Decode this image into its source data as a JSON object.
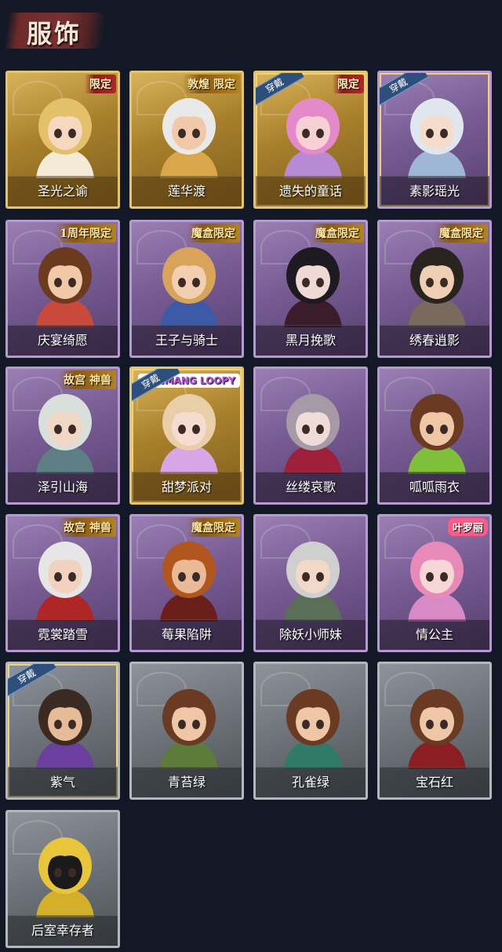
{
  "page": {
    "title": "服饰"
  },
  "cards": [
    {
      "name": "圣光之谕",
      "badge": "限定",
      "badge_style": "red",
      "frame": "gold",
      "worn": false,
      "hair": "#e4c06a",
      "skin": "#f6d8c0",
      "cloth": "#f3ead8"
    },
    {
      "name": "莲华渡",
      "badge": "敦煌 限定",
      "badge_style": "yellow",
      "frame": "gold",
      "worn": false,
      "hair": "#e9e9e9",
      "skin": "#f0caa8",
      "cloth": "#d9a64a"
    },
    {
      "name": "遗失的童话",
      "badge": "限定",
      "badge_style": "red",
      "frame": "gold",
      "worn": true,
      "worn_tag": "穿戴",
      "hair": "#e48acb",
      "skin": "#f7d0d6",
      "cloth": "#b88ad6"
    },
    {
      "name": "素影瑶光",
      "badge": "",
      "badge_style": "",
      "frame": "purple",
      "worn": true,
      "worn_tag": "穿戴",
      "hair": "#dfe6ee",
      "skin": "#f5dccd",
      "cloth": "#9fb6d6"
    },
    {
      "name": "庆宴绮愿",
      "badge": "1周年限定",
      "badge_style": "yellow",
      "frame": "purple",
      "worn": false,
      "hair": "#6b3a1f",
      "skin": "#f1c8a8",
      "cloth": "#c94a3b"
    },
    {
      "name": "王子与骑士",
      "badge": "魔盒限定",
      "badge_style": "yellow",
      "frame": "purple",
      "worn": false,
      "hair": "#d8a45a",
      "skin": "#f2cfb0",
      "cloth": "#3d5aa8"
    },
    {
      "name": "黑月挽歌",
      "badge": "魔盒限定",
      "badge_style": "yellow",
      "frame": "purple",
      "worn": false,
      "hair": "#1e1a22",
      "skin": "#efd9d4",
      "cloth": "#3a1c2a"
    },
    {
      "name": "绣春逍影",
      "badge": "魔盒限定",
      "badge_style": "yellow",
      "frame": "purple",
      "worn": false,
      "hair": "#2a2420",
      "skin": "#efcfb4",
      "cloth": "#7a6a5e"
    },
    {
      "name": "泽引山海",
      "badge": "故宫 神兽",
      "badge_style": "yellow",
      "frame": "purple",
      "worn": false,
      "hair": "#d9e0dc",
      "skin": "#f1d8c6",
      "cloth": "#5e7e86"
    },
    {
      "name": "甜梦派对",
      "badge": "ZANMANG LOOPY",
      "badge_style": "loopy",
      "frame": "gold",
      "worn": true,
      "worn_tag": "穿戴",
      "hair": "#e8cfa8",
      "skin": "#f6dcd0",
      "cloth": "#d7a6e6"
    },
    {
      "name": "丝缕哀歌",
      "badge": "",
      "badge_style": "",
      "frame": "purple",
      "worn": false,
      "hair": "#a59aa6",
      "skin": "#efdcd9",
      "cloth": "#9d1f3a"
    },
    {
      "name": "呱呱雨衣",
      "badge": "",
      "badge_style": "",
      "frame": "purple",
      "worn": false,
      "hair": "#6a3a22",
      "skin": "#efc7a6",
      "cloth": "#7fbf3a"
    },
    {
      "name": "霓裳踏雪",
      "badge": "故宫 神兽",
      "badge_style": "yellow",
      "frame": "purple",
      "worn": false,
      "hair": "#e6e6e6",
      "skin": "#f0d2be",
      "cloth": "#b02626"
    },
    {
      "name": "莓果陷阱",
      "badge": "魔盒限定",
      "badge_style": "yellow",
      "frame": "purple",
      "worn": false,
      "hair": "#b0561e",
      "skin": "#e9b998",
      "cloth": "#6b1f1a"
    },
    {
      "name": "除妖小师妹",
      "badge": "",
      "badge_style": "",
      "frame": "purple",
      "worn": false,
      "hair": "#cfcfcf",
      "skin": "#f1d8c8",
      "cloth": "#5a6e58"
    },
    {
      "name": "情公主",
      "badge": "叶罗丽",
      "badge_style": "pink",
      "frame": "purple",
      "worn": false,
      "hair": "#e88ab8",
      "skin": "#f6d6d6",
      "cloth": "#d88ac6"
    },
    {
      "name": "紫气",
      "badge": "",
      "badge_style": "",
      "frame": "grey",
      "worn": true,
      "worn_tag": "穿戴",
      "hair": "#3a2a22",
      "skin": "#e6bc98",
      "cloth": "#6b3f9e"
    },
    {
      "name": "青苔绿",
      "badge": "",
      "badge_style": "",
      "frame": "grey",
      "worn": false,
      "hair": "#6a3a22",
      "skin": "#efc7a6",
      "cloth": "#5d7b3a"
    },
    {
      "name": "孔雀绿",
      "badge": "",
      "badge_style": "",
      "frame": "grey",
      "worn": false,
      "hair": "#6a3a22",
      "skin": "#efc7a6",
      "cloth": "#2f7a68"
    },
    {
      "name": "宝石红",
      "badge": "",
      "badge_style": "",
      "frame": "grey",
      "worn": false,
      "hair": "#6a3a22",
      "skin": "#efc7a6",
      "cloth": "#8a1e22"
    },
    {
      "name": "后室幸存者",
      "badge": "",
      "badge_style": "",
      "frame": "grey",
      "worn": false,
      "hair": "#e8c53a",
      "skin": "#1a1a1a",
      "cloth": "#d4b02a"
    }
  ]
}
